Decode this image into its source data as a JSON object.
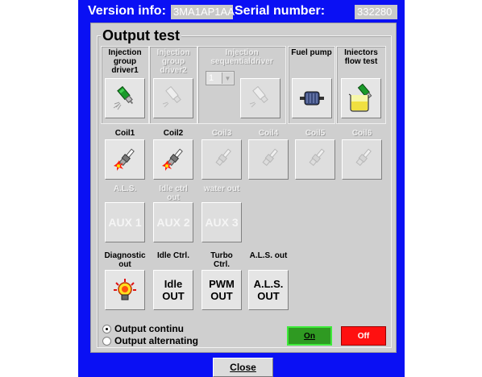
{
  "header": {
    "version_label": "Version info:",
    "version_value": "3MA1AP1AA",
    "serial_label": "Serial number:",
    "serial_value": "332280"
  },
  "panel": {
    "title": "Output test"
  },
  "injection": {
    "group1_label": "Injection group driver1",
    "group2_label": "Injection group driver2",
    "sequential_label": "Injection sequentialdriver",
    "sequential_value": "1",
    "fuel_pump_label": "Fuel pump",
    "flow_test_label": "Iniectors flow test"
  },
  "coils": {
    "labels": [
      "Coil1",
      "Coil2",
      "Coil3",
      "Coil4",
      "Coil5",
      "Coil6"
    ],
    "enabled": [
      true,
      true,
      false,
      false,
      false,
      false
    ]
  },
  "aux": {
    "labels": [
      "A.L.S.",
      "Idle ctrl out",
      "water out"
    ],
    "buttons": [
      "AUX 1",
      "AUX 2",
      "AUX 3"
    ]
  },
  "outputs": {
    "diagnostic_label": "Diagnostic out",
    "idle_label": "Idle Ctrl.",
    "turbo_label": "Turbo Ctrl.",
    "als_label": "A.L.S. out",
    "idle_btn": [
      "Idle",
      "OUT"
    ],
    "pwm_btn": [
      "PWM",
      "OUT"
    ],
    "als_btn": [
      "A.L.S.",
      "OUT"
    ]
  },
  "mode": {
    "continuous_label": "Output continu",
    "alternating_label": "Output alternating",
    "selected": "continuous"
  },
  "buttons": {
    "on_label": "On",
    "off_label": "Off",
    "close_label": "Close"
  },
  "colors": {
    "background_blue": "#0a10f4",
    "on_green": "#2f9a22",
    "off_red": "#ff1010"
  },
  "icons": [
    "injector-icon",
    "fuel-pump-icon",
    "beaker-icon",
    "spark-plug-icon",
    "bulb-icon"
  ]
}
